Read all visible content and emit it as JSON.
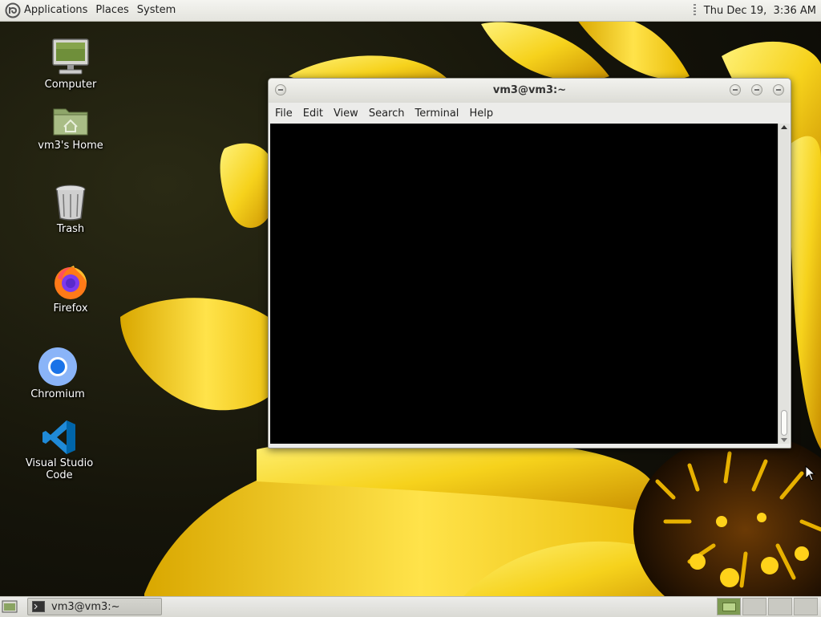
{
  "top_panel": {
    "menus": [
      "Applications",
      "Places",
      "System"
    ],
    "clock": "Thu Dec 19,  3:36 AM"
  },
  "desktop": {
    "icons": [
      {
        "label": "Computer",
        "icon": "computer-icon"
      },
      {
        "label": "vm3's Home",
        "icon": "home-folder-icon"
      },
      {
        "label": "Trash",
        "icon": "trash-icon"
      },
      {
        "label": "Firefox",
        "icon": "firefox-icon"
      },
      {
        "label": "Chromium",
        "icon": "chromium-icon"
      },
      {
        "label": "Visual Studio Code",
        "icon": "vscode-icon"
      }
    ]
  },
  "terminal": {
    "title": "vm3@vm3:~",
    "menu": [
      "File",
      "Edit",
      "View",
      "Search",
      "Terminal",
      "Help"
    ],
    "background": "#000000"
  },
  "bottom_panel": {
    "taskbar_item": "vm3@vm3:~",
    "workspaces": 4,
    "active_workspace": 1
  },
  "colors": {
    "panel": "#e8e8e2",
    "workspace_active": "#7d9a52"
  }
}
